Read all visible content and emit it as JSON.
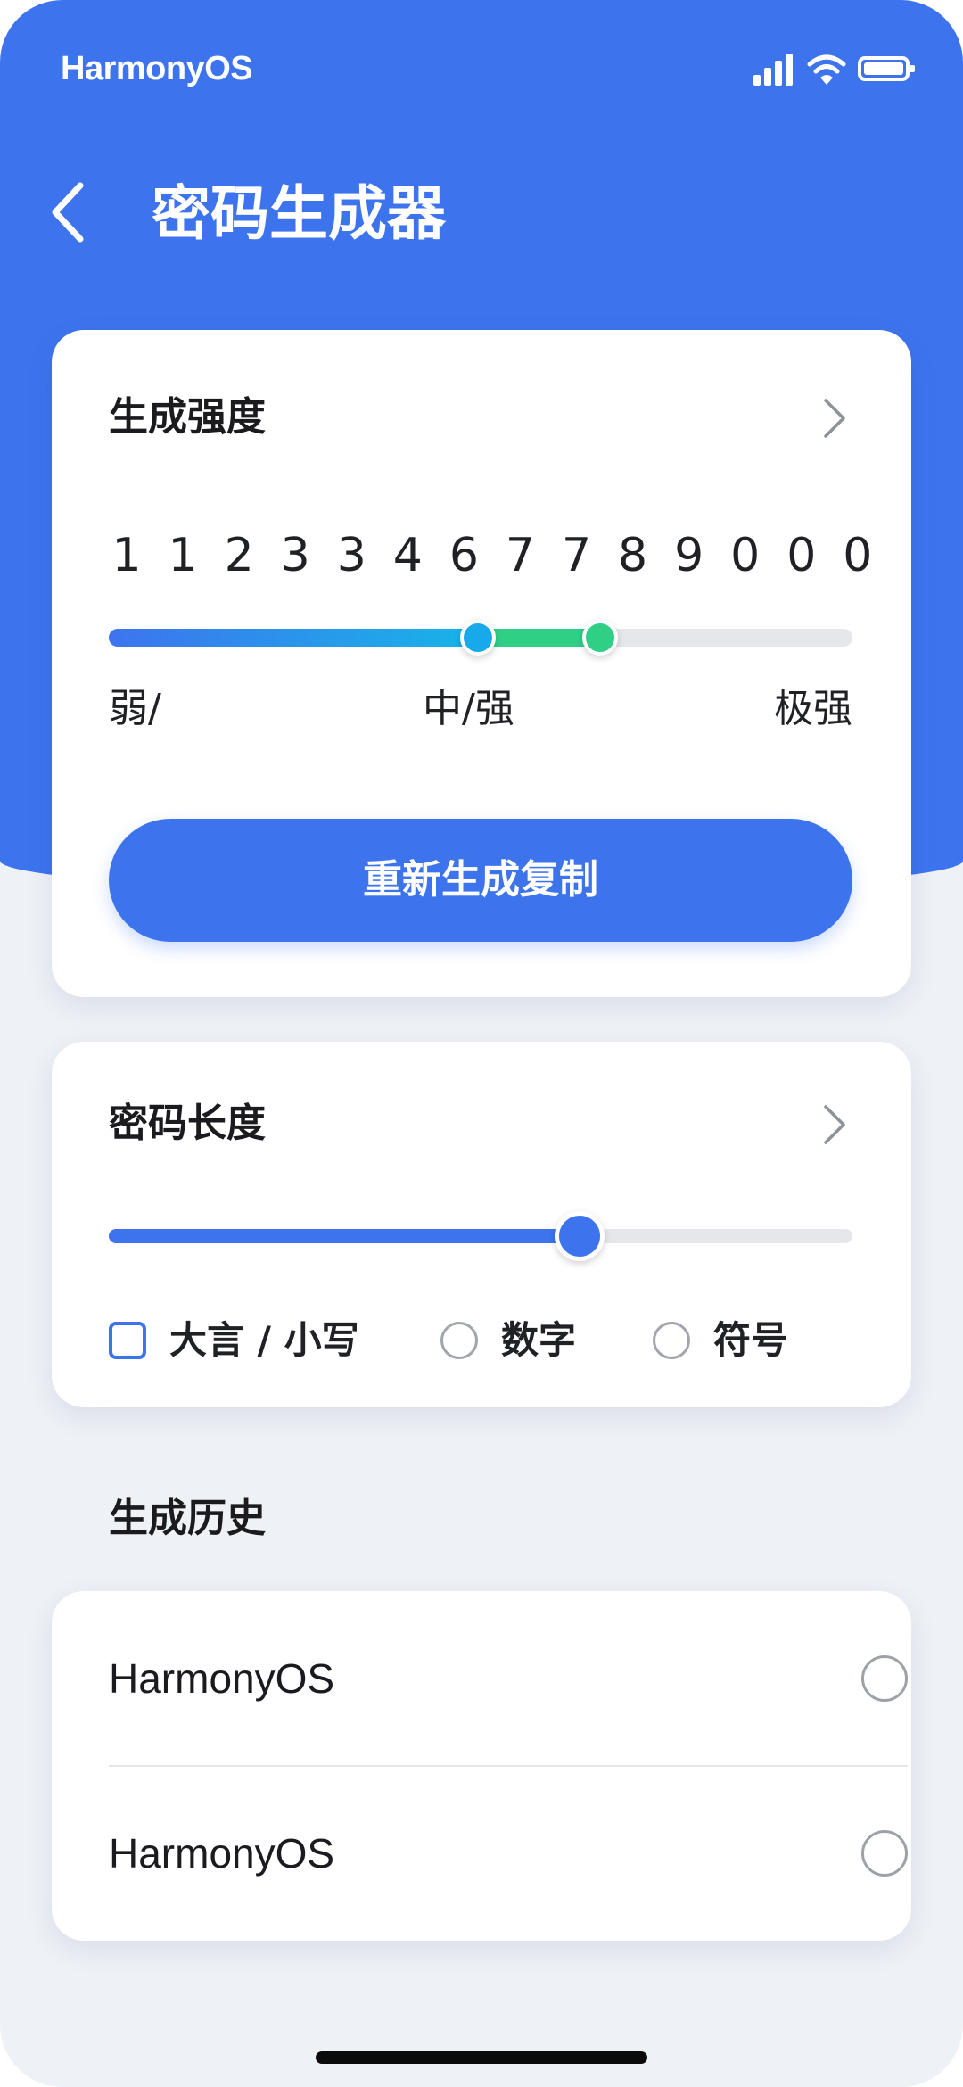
{
  "status_bar": {
    "brand": "HarmonyOS",
    "icons": [
      "signal-icon",
      "wifi-icon",
      "battery-icon"
    ]
  },
  "app_bar": {
    "back_icon": "chevron-left-icon",
    "title": "密码生成器"
  },
  "strength_card": {
    "title": "生成强度",
    "chevron_icon": "chevron-right-icon",
    "password_digits": [
      "1",
      "1",
      "2",
      "3",
      "3",
      "4",
      "6",
      "7",
      "7",
      "8",
      "9",
      "0",
      "0",
      "0"
    ],
    "slider": {
      "knob1_fraction": 0.496,
      "knob2_fraction": 0.661,
      "colors": {
        "seg1_start": "#3d74ee",
        "seg1_end": "#18b4e8",
        "seg2": "#2fcf86",
        "track": "#e6e7ea"
      }
    },
    "labels": {
      "weak": "弱/",
      "medium_strong": "中/强",
      "very_strong": "极强"
    },
    "button_label": "重新生成复制"
  },
  "length_card": {
    "title": "密码长度",
    "chevron_icon": "chevron-right-icon",
    "slider_fraction": 0.633,
    "options": [
      {
        "label": "大言 / 小写",
        "type": "checkbox",
        "checked": false
      },
      {
        "label": "数字",
        "type": "radio",
        "checked": false
      },
      {
        "label": "符号",
        "type": "radio",
        "checked": false
      }
    ]
  },
  "history": {
    "section_title": "生成历史",
    "items": [
      {
        "name": "HarmonyOS",
        "selected": false
      },
      {
        "name": "HarmonyOS",
        "selected": false
      }
    ]
  },
  "theme": {
    "accent": "#3d74ee",
    "background": "#eef1f6",
    "card": "#ffffff"
  }
}
